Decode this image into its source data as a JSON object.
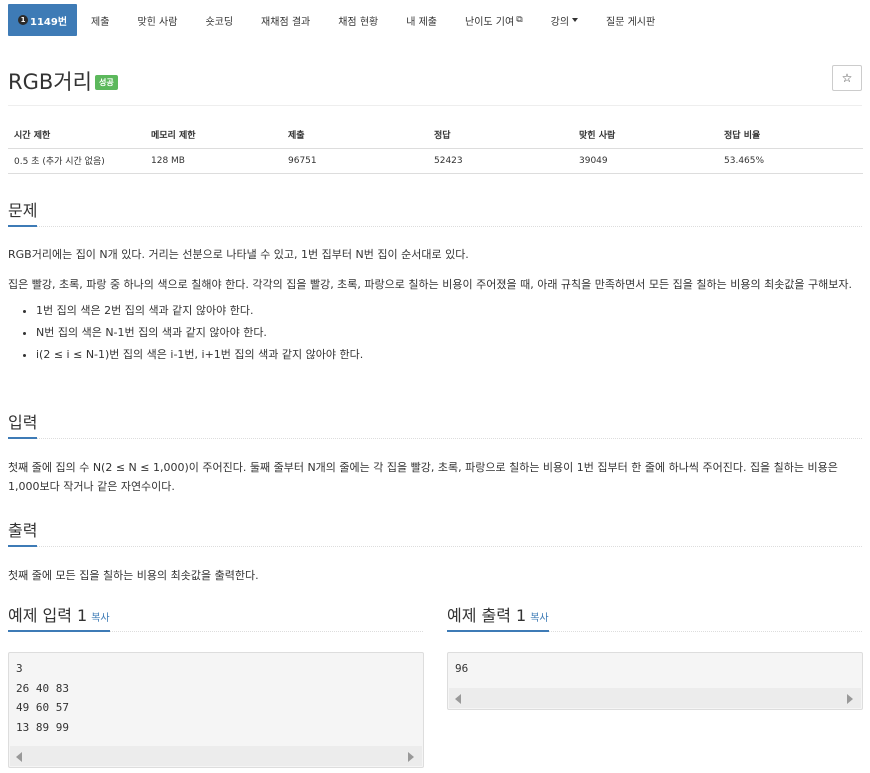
{
  "nav": {
    "tabs": [
      {
        "label": "1149번",
        "active": true,
        "icon": "tier-badge-icon",
        "badge": "1"
      },
      {
        "label": "제출"
      },
      {
        "label": "맞힌 사람"
      },
      {
        "label": "숏코딩"
      },
      {
        "label": "재채점 결과"
      },
      {
        "label": "채점 현황"
      },
      {
        "label": "내 제출"
      },
      {
        "label": "난이도 기여",
        "icon": "external-link-icon",
        "icon_glyph": "⧉"
      },
      {
        "label": "강의",
        "icon": "caret-down-icon"
      },
      {
        "label": "질문 게시판"
      }
    ]
  },
  "problem": {
    "title": "RGB거리",
    "status": "성공",
    "star": "☆"
  },
  "info_table": {
    "headers": [
      "시간 제한",
      "메모리 제한",
      "제출",
      "정답",
      "맞힌 사람",
      "정답 비율"
    ],
    "row": [
      "0.5 초 (추가 시간 없음)",
      "128 MB",
      "96751",
      "52423",
      "39049",
      "53.465%"
    ]
  },
  "sections": {
    "problem": {
      "heading": "문제",
      "p1": "RGB거리에는 집이 N개 있다. 거리는 선분으로 나타낼 수 있고, 1번 집부터 N번 집이 순서대로 있다.",
      "p2": "집은 빨강, 초록, 파랑 중 하나의 색으로 칠해야 한다. 각각의 집을 빨강, 초록, 파랑으로 칠하는 비용이 주어졌을 때, 아래 규칙을 만족하면서 모든 집을 칠하는 비용의 최솟값을 구해보자.",
      "rules": [
        "1번 집의 색은 2번 집의 색과 같지 않아야 한다.",
        "N번 집의 색은 N-1번 집의 색과 같지 않아야 한다.",
        "i(2 ≤ i ≤ N-1)번 집의 색은 i-1번, i+1번 집의 색과 같지 않아야 한다."
      ]
    },
    "input": {
      "heading": "입력",
      "text": "첫째 줄에 집의 수 N(2 ≤ N ≤ 1,000)이 주어진다. 둘째 줄부터 N개의 줄에는 각 집을 빨강, 초록, 파랑으로 칠하는 비용이 1번 집부터 한 줄에 하나씩 주어진다. 집을 칠하는 비용은 1,000보다 작거나 같은 자연수이다."
    },
    "output": {
      "heading": "출력",
      "text": "첫째 줄에 모든 집을 칠하는 비용의 최솟값을 출력한다."
    }
  },
  "samples": {
    "input": {
      "heading": "예제 입력 1",
      "copy": "복사",
      "content": "3\n26 40 83\n49 60 57\n13 89 99"
    },
    "output": {
      "heading": "예제 출력 1",
      "copy": "복사",
      "content": "96"
    }
  }
}
